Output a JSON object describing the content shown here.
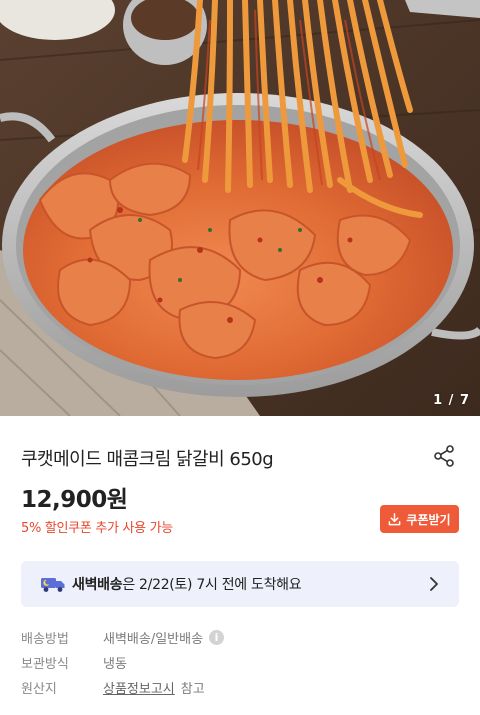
{
  "gallery": {
    "counter": "1 / 7",
    "image_description_icon": "food-photo"
  },
  "product": {
    "title": "쿠캣메이드 매콤크림 닭갈비 650g",
    "price": "12,900원",
    "coupon_note": "5% 할인쿠폰 추가 사용 가능",
    "coupon_button": "쿠폰받기"
  },
  "delivery": {
    "strong": "새벽배송",
    "rest": "은 2/22(토) 7시 전에 도착해요"
  },
  "details": [
    {
      "label": "배송방법",
      "value": "새벽배송/일반배송"
    },
    {
      "label": "보관방식",
      "value": "냉동"
    },
    {
      "label": "원산지",
      "link": "상품정보고시",
      "suffix": "참고"
    }
  ],
  "colors": {
    "accent": "#ef5a38",
    "coupon_text": "#e8482e",
    "delivery_bg": "#eef0fb"
  }
}
